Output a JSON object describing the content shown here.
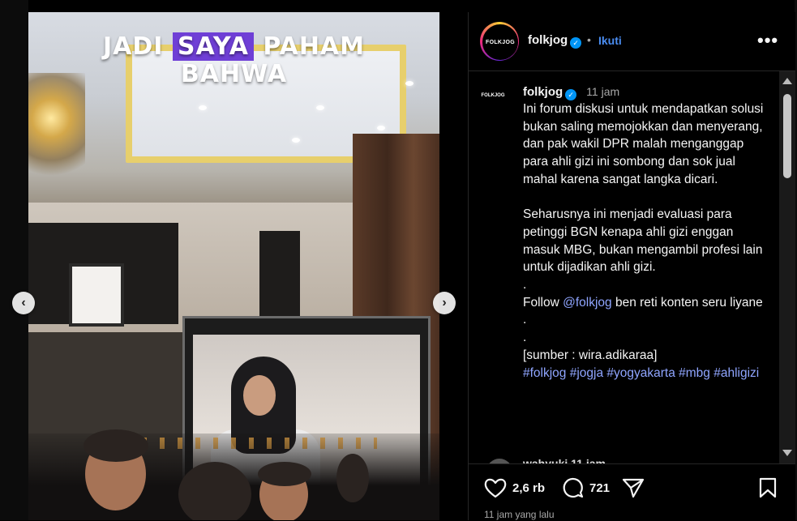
{
  "media": {
    "caption_prefix": "JADI ",
    "caption_highlight": "SAYA",
    "caption_suffix": " PAHAM",
    "caption_line2": "BAHWA",
    "prev_label": "‹",
    "next_label": "›"
  },
  "post": {
    "username": "folkjog",
    "avatar_text": "FOLKJOG",
    "follow_separator": "•",
    "follow_label": "Ikuti",
    "more_label": "•••"
  },
  "comment": {
    "username": "folkjog",
    "time": "11 jam",
    "para1": "Ini forum diskusi untuk mendapatkan solusi bukan saling memojokkan dan menyerang, dan pak wakil DPR malah menganggap para ahli gizi ini sombong dan sok jual mahal karena sangat langka dicari.",
    "para2": "Seharusnya ini menjadi evaluasi para petinggi BGN kenapa ahli gizi enggan masuk MBG, bukan mengambil profesi lain untuk dijadikan ahli gizi.",
    "dot1": ".",
    "follow_prefix": "Follow ",
    "follow_mention": "@folkjog",
    "follow_suffix": " ben reti konten seru liyane",
    "dot2": ".",
    "dot3": ".",
    "source": "[sumber : wira.adikaraa]",
    "hashtags": "#folkjog #jogja #yogyakarta #mbg #ahligizi",
    "next_preview": "wahyuki  11 jam"
  },
  "footer": {
    "likes": "2,6 rb",
    "comments": "721",
    "timestamp": "11 jam yang lalu"
  }
}
